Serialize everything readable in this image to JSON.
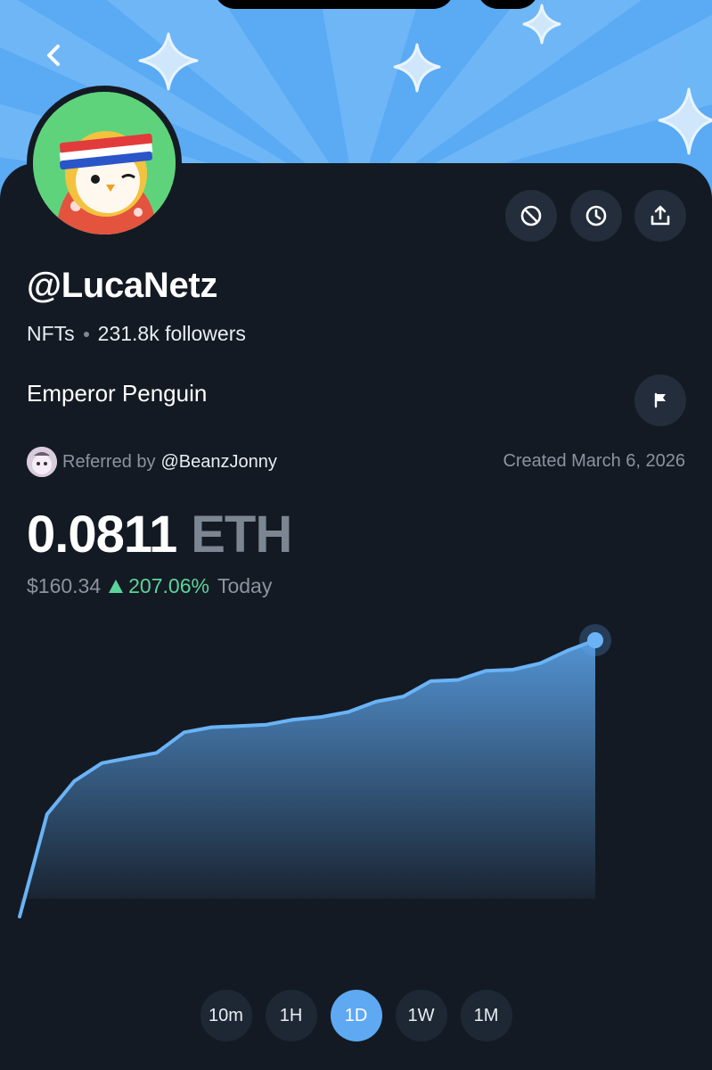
{
  "profile": {
    "username": "@LucaNetz",
    "category": "NFTs",
    "followers": "231.8k followers",
    "display_name": "Emperor Penguin",
    "referral_label": "Referred by",
    "referral_user": "@BeanzJonny",
    "created": "Created March 6, 2026"
  },
  "price": {
    "value": "0.0811",
    "unit": "ETH",
    "usd": "$160.34",
    "change_pct": "207.06%",
    "period": "Today"
  },
  "actions": [
    "block-icon",
    "clock-icon",
    "share-icon",
    "flag-icon"
  ],
  "ranges": [
    "10m",
    "1H",
    "1D",
    "1W",
    "1M"
  ],
  "active_range": "1D",
  "colors": {
    "banner": "#5aaaf4",
    "background": "#141a23",
    "accent": "#5ea9f2",
    "positive": "#5bd49a"
  },
  "chart_data": {
    "type": "area",
    "x": [
      0,
      1,
      2,
      3,
      4,
      5,
      6,
      7,
      8,
      9,
      10,
      11,
      12,
      13,
      14,
      15,
      16,
      17,
      18,
      19,
      20,
      21
    ],
    "values": [
      0.0,
      0.4,
      0.53,
      0.6,
      0.62,
      0.64,
      0.72,
      0.74,
      0.745,
      0.75,
      0.77,
      0.78,
      0.8,
      0.84,
      0.86,
      0.92,
      0.925,
      0.96,
      0.965,
      0.99,
      1.04,
      1.08
    ],
    "ylim": [
      0,
      1.08
    ],
    "xlabel": "",
    "ylabel": ""
  }
}
